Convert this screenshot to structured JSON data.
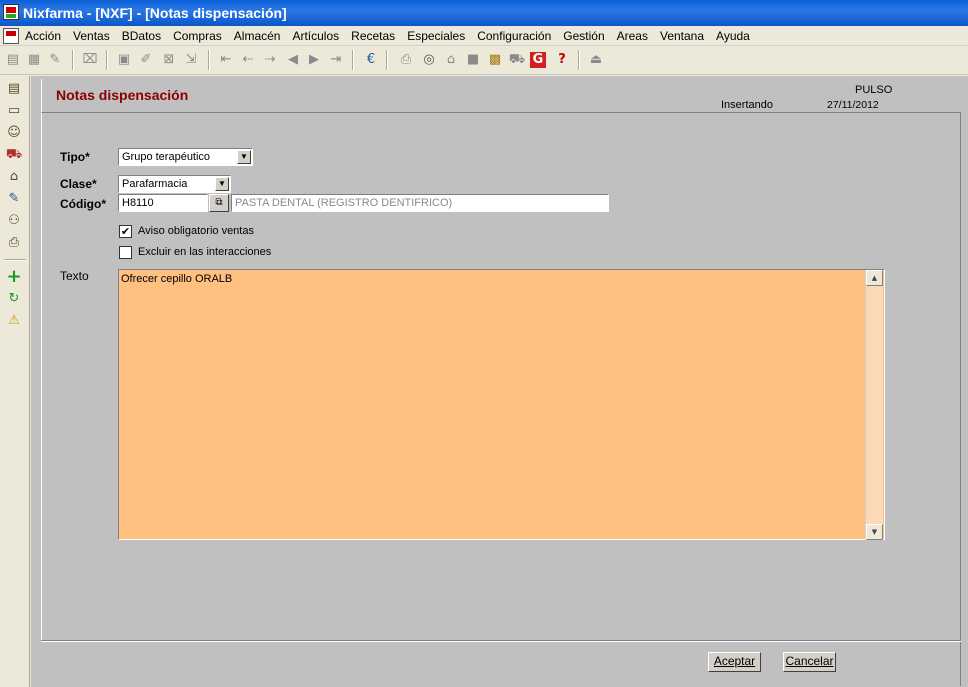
{
  "window": {
    "title": "Nixfarma - [NXF] - [Notas dispensación]"
  },
  "menu": [
    "Acción",
    "Ventas",
    "BDatos",
    "Compras",
    "Almacén",
    "Artículos",
    "Recetas",
    "Especiales",
    "Configuración",
    "Gestión",
    "Areas",
    "Ventana",
    "Ayuda"
  ],
  "toolbar": {
    "icons": [
      "new-icon",
      "edit-icon",
      "copy-icon",
      "save-icon",
      "print-preview-icon",
      "delete-icon",
      "export-icon",
      "first-icon",
      "prev-icon",
      "next-icon",
      "last-icon",
      "euro-icon",
      "printer-icon",
      "search-icon",
      "lock-icon",
      "stop-icon",
      "calendar-icon",
      "cart-icon",
      "g-icon",
      "help-icon",
      "upload-icon"
    ]
  },
  "lefttools": {
    "icons": [
      "register-icon",
      "card-icon",
      "user-icon",
      "cart-icon",
      "building-icon",
      "pencil-icon",
      "people-icon",
      "printer-icon",
      "add-icon",
      "refresh-icon",
      "warning-icon"
    ]
  },
  "form": {
    "title": "Notas dispensación",
    "pulso": "PULSO",
    "mode": "Insertando",
    "date": "27/11/2012",
    "tipo_label": "Tipo*",
    "tipo_value": "Grupo terapéutico",
    "clase_label": "Clase*",
    "clase_value": "Parafarmacia",
    "codigo_label": "Código*",
    "codigo_value": "H8110",
    "codigo_description": "PASTA DENTAL (REGISTRO DENTIFRICO)",
    "aviso_label": "Aviso obligatorio ventas",
    "aviso_checked": true,
    "excluir_label": "Excluir en las interacciones",
    "excluir_checked": false,
    "texto_label": "Texto",
    "texto_value": "Ofrecer cepillo ORALB",
    "aceptar_label": "Aceptar",
    "cancelar_label": "Cancelar"
  },
  "colors": {
    "title_red": "#8b0000",
    "textarea_bg": "#ffc080",
    "form_bg": "#c0c0c0"
  }
}
